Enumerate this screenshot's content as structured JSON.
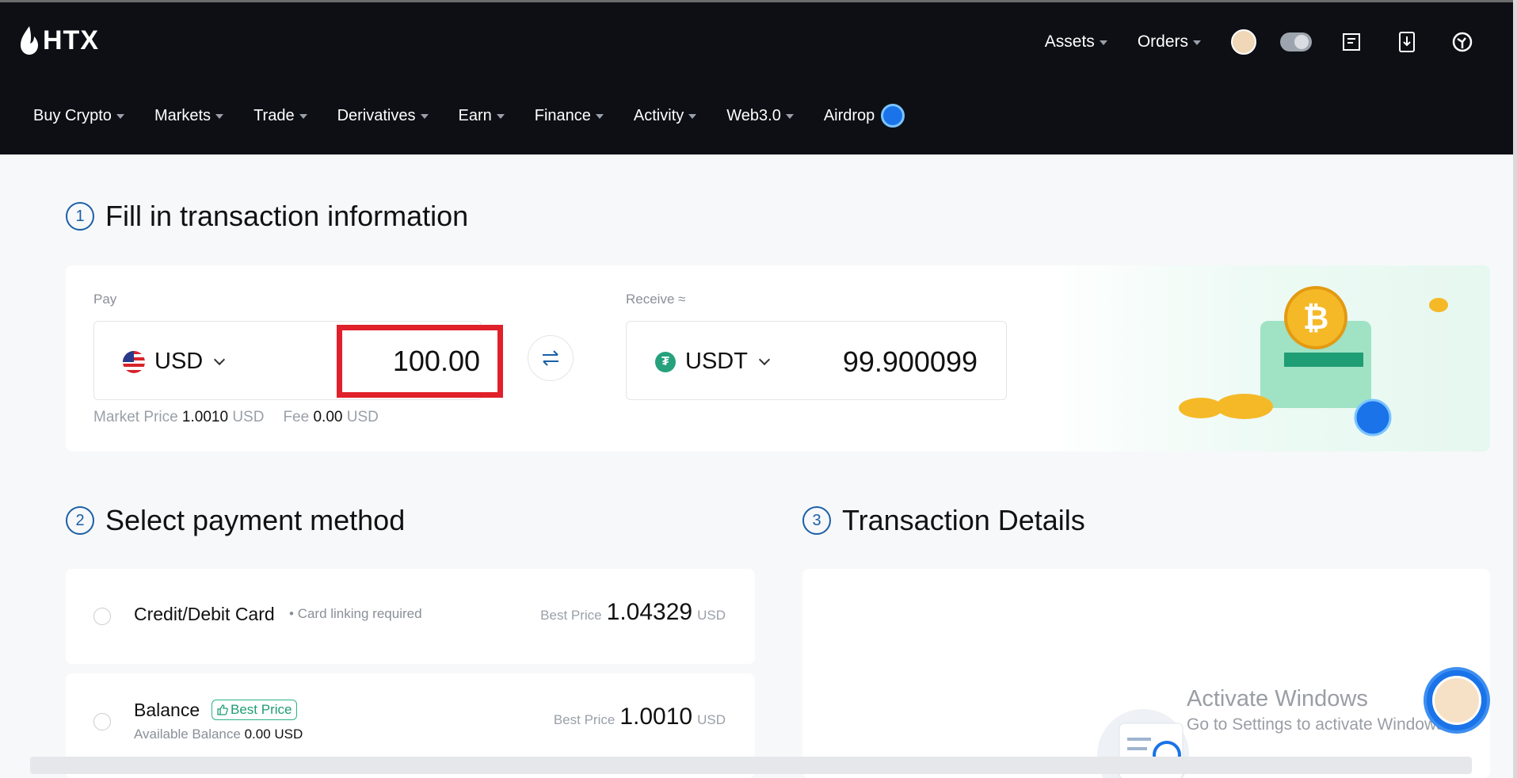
{
  "header": {
    "logo": "HTX",
    "top_menu": [
      {
        "label": "Assets"
      },
      {
        "label": "Orders"
      }
    ],
    "toggle_value": "0",
    "nav": [
      {
        "label": "Buy Crypto"
      },
      {
        "label": "Markets"
      },
      {
        "label": "Trade"
      },
      {
        "label": "Derivatives"
      },
      {
        "label": "Earn"
      },
      {
        "label": "Finance"
      },
      {
        "label": "Activity"
      },
      {
        "label": "Web3.0"
      },
      {
        "label": "Airdrop"
      }
    ]
  },
  "step1": {
    "number": "1",
    "title": "Fill in transaction information",
    "pay_label": "Pay",
    "pay_currency": "USD",
    "pay_amount": "100.00",
    "receive_label": "Receive ≈",
    "receive_currency": "USDT",
    "receive_amount": "99.900099",
    "market_price_label": "Market Price",
    "market_price_value": "1.0010",
    "market_price_unit": "USD",
    "fee_label": "Fee",
    "fee_value": "0.00",
    "fee_unit": "USD"
  },
  "step2": {
    "number": "2",
    "title": "Select payment method",
    "methods": [
      {
        "name": "Credit/Debit Card",
        "note": "Card linking required",
        "price_label": "Best Price",
        "price_value": "1.04329",
        "price_unit": "USD"
      },
      {
        "name": "Balance",
        "badge": "Best Price",
        "available_label": "Available Balance",
        "available_value": "0.00 USD",
        "price_label": "Best Price",
        "price_value": "1.0010",
        "price_unit": "USD"
      }
    ]
  },
  "step3": {
    "number": "3",
    "title": "Transaction Details"
  },
  "watermark": {
    "line1": "Activate Windows",
    "line2": "Go to Settings to activate Windows."
  },
  "colors": {
    "header_bg": "#0d0f14",
    "accent_blue": "#1a5fa8",
    "highlight_red": "#e0202a",
    "usdt_green": "#26a17b",
    "badge_green": "#1f9d74"
  }
}
